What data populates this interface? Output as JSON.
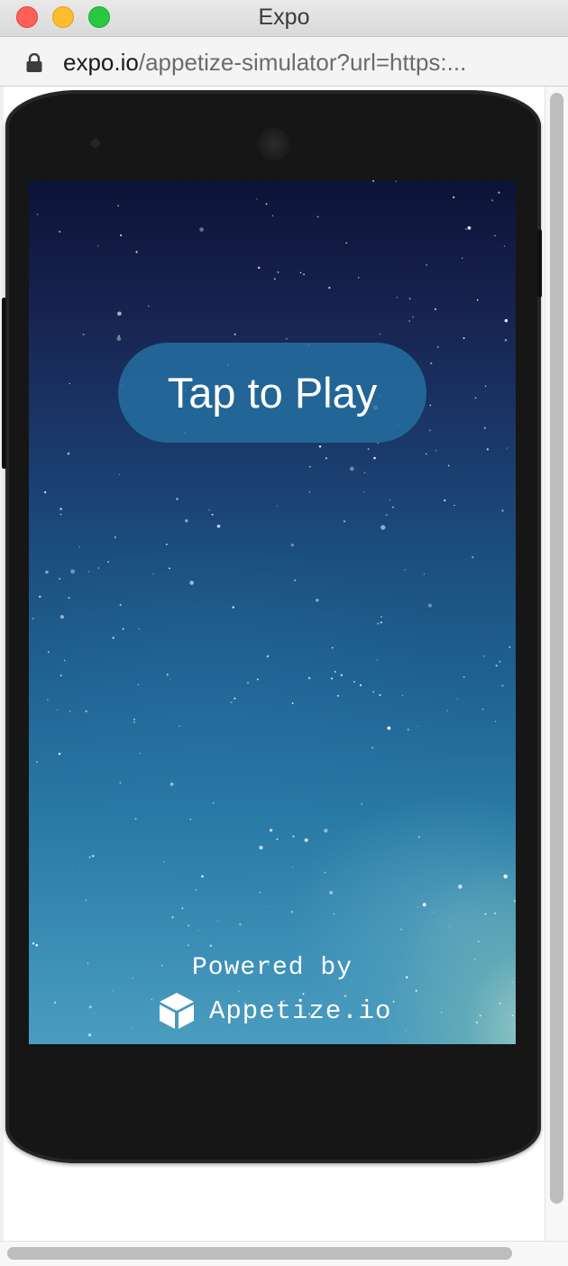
{
  "window": {
    "title": "Expo"
  },
  "address_bar": {
    "url_domain": "expo.io",
    "url_path": "/appetize-simulator?url=https:..."
  },
  "simulator": {
    "play_button_label": "Tap to Play",
    "powered_by_label": "Powered by",
    "provider_name": "Appetize.io"
  },
  "colors": {
    "play_button": "#246ea0",
    "screen_top": "#0c1338",
    "screen_bottom": "#4b9dbf",
    "phone_body": "#161616"
  },
  "icons": {
    "lock": "lock-icon",
    "provider_logo": "cube-icon"
  }
}
